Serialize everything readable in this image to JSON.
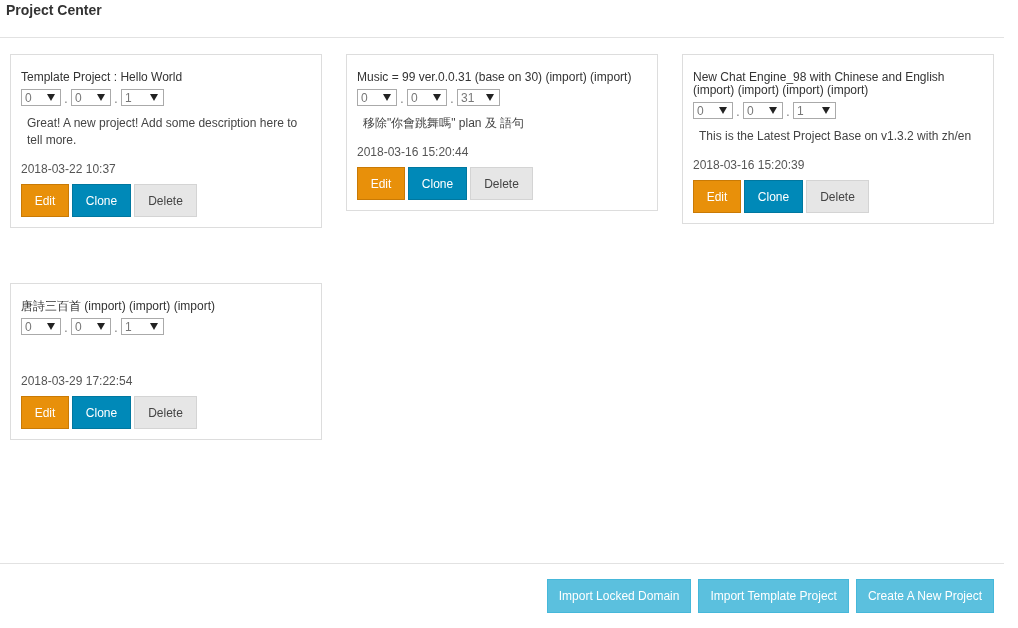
{
  "page": {
    "title": "Project Center"
  },
  "projects": [
    {
      "name": "Template Project : Hello World",
      "version": [
        "0",
        "0",
        "1"
      ],
      "version_separators": [
        ".",
        "."
      ],
      "description": "Great! A new project! Add some description here to tell more.",
      "timestamp": "2018-03-22 10:37",
      "actions": [
        "Edit",
        "Clone",
        "Delete"
      ]
    },
    {
      "name": "Music = 99 ver.0.0.31 (base on 30) (import) (import)",
      "version": [
        "0",
        "0",
        "31"
      ],
      "version_separators": [
        ".",
        "."
      ],
      "description": "移除\"你會跳舞嗎\" plan 及 語句",
      "timestamp": "2018-03-16 15:20:44",
      "actions": [
        "Edit",
        "Clone",
        "Delete"
      ]
    },
    {
      "name": "New Chat Engine_98 with Chinese and English (import) (import) (import) (import)",
      "version": [
        "0",
        "0",
        "1"
      ],
      "version_separators": [
        ".",
        "."
      ],
      "description": "This is the Latest Project Base on v1.3.2 with zh/en",
      "timestamp": "2018-03-16 15:20:39",
      "actions": [
        "Edit",
        "Clone",
        "Delete"
      ]
    },
    {
      "name": "唐詩三百首 (import) (import) (import)",
      "version": [
        "0",
        "0",
        "1"
      ],
      "version_separators": [
        ".",
        "."
      ],
      "timestamp": "2018-03-29 17:22:54",
      "actions": [
        "Edit",
        "Clone",
        "Delete"
      ]
    }
  ],
  "footer_buttons": [
    "Import Locked Domain",
    "Import Template Project",
    "Create A New Project"
  ]
}
